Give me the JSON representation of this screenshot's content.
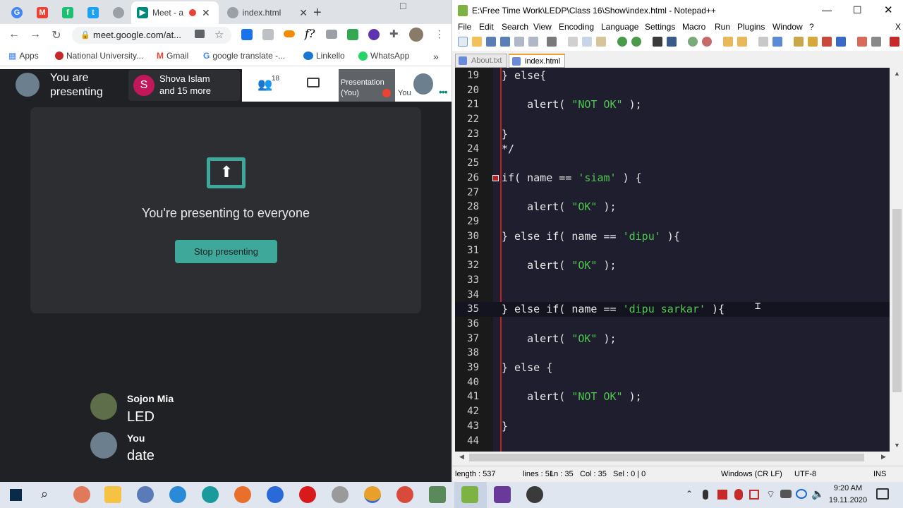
{
  "browser": {
    "tabs": [
      {
        "label": "Meet - a",
        "active": true
      },
      {
        "label": "index.html",
        "active": false
      }
    ],
    "new_tab": "+",
    "address": "meet.google.com/at...",
    "bookmarks": [
      "Apps",
      "National University...",
      "Gmail",
      "google translate -...",
      "Linkello",
      "WhatsApp"
    ],
    "overflow": "»"
  },
  "meet": {
    "presenting_text": "You are presenting",
    "participant_name": "Shova Islam",
    "participant_more": "and 15 more",
    "participant_initial": "S",
    "people_count": "18",
    "presentation_label": "Presentation (You)",
    "you_label": "You",
    "card_message": "You're presenting to everyone",
    "stop_button": "Stop presenting",
    "chat": [
      {
        "name": "Sojon Mia",
        "message": "LED"
      },
      {
        "name": "You",
        "message": "date"
      }
    ]
  },
  "notepad": {
    "title": "E:\\Free Time Work\\LEDP\\Class 16\\Show\\index.html - Notepad++",
    "menu": [
      "File",
      "Edit",
      "Search",
      "View",
      "Encoding",
      "Language",
      "Settings",
      "Macro",
      "Run",
      "Plugins",
      "Window",
      "?"
    ],
    "close_x": "X",
    "tabs": [
      "About.txt",
      "index.html"
    ],
    "lines": [
      {
        "n": "19",
        "c": "} else{"
      },
      {
        "n": "20",
        "c": ""
      },
      {
        "n": "21",
        "c": "    alert( ",
        "s": "\"NOT OK\"",
        "e": " );"
      },
      {
        "n": "22",
        "c": ""
      },
      {
        "n": "23",
        "c": "}"
      },
      {
        "n": "24",
        "c": "*/"
      },
      {
        "n": "25",
        "c": ""
      },
      {
        "n": "26",
        "c": "if( name == ",
        "s": "'siam'",
        "e": " ) {"
      },
      {
        "n": "27",
        "c": ""
      },
      {
        "n": "28",
        "c": "    alert( ",
        "s": "\"OK\"",
        "e": " );"
      },
      {
        "n": "29",
        "c": ""
      },
      {
        "n": "30",
        "c": "} else if( name == ",
        "s": "'dipu'",
        "e": " ){"
      },
      {
        "n": "31",
        "c": ""
      },
      {
        "n": "32",
        "c": "    alert( ",
        "s": "\"OK\"",
        "e": " );"
      },
      {
        "n": "33",
        "c": ""
      },
      {
        "n": "34",
        "c": ""
      },
      {
        "n": "35",
        "c": "} else if( name == ",
        "s": "'dipu sarkar'",
        "e": " ){"
      },
      {
        "n": "36",
        "c": ""
      },
      {
        "n": "37",
        "c": "    alert( ",
        "s": "\"OK\"",
        "e": " );"
      },
      {
        "n": "38",
        "c": ""
      },
      {
        "n": "39",
        "c": "} else {"
      },
      {
        "n": "40",
        "c": ""
      },
      {
        "n": "41",
        "c": "    alert( ",
        "s": "\"NOT OK\"",
        "e": " );"
      },
      {
        "n": "42",
        "c": ""
      },
      {
        "n": "43",
        "c": "}"
      },
      {
        "n": "44",
        "c": ""
      }
    ],
    "status": {
      "length": "length : 537",
      "lines": "lines : 51",
      "ln": "Ln : 35",
      "col": "Col : 35",
      "sel": "Sel : 0 | 0",
      "eol": "Windows (CR LF)",
      "encoding": "UTF-8",
      "mode": "INS"
    }
  },
  "taskbar": {
    "time": "9:20 AM",
    "date": "19.11.2020"
  },
  "colors": {
    "meet_bg": "#202124",
    "meet_accent": "#3ea89b",
    "editor_bg": "#1e1e2e",
    "string_green": "#4ec94e"
  }
}
